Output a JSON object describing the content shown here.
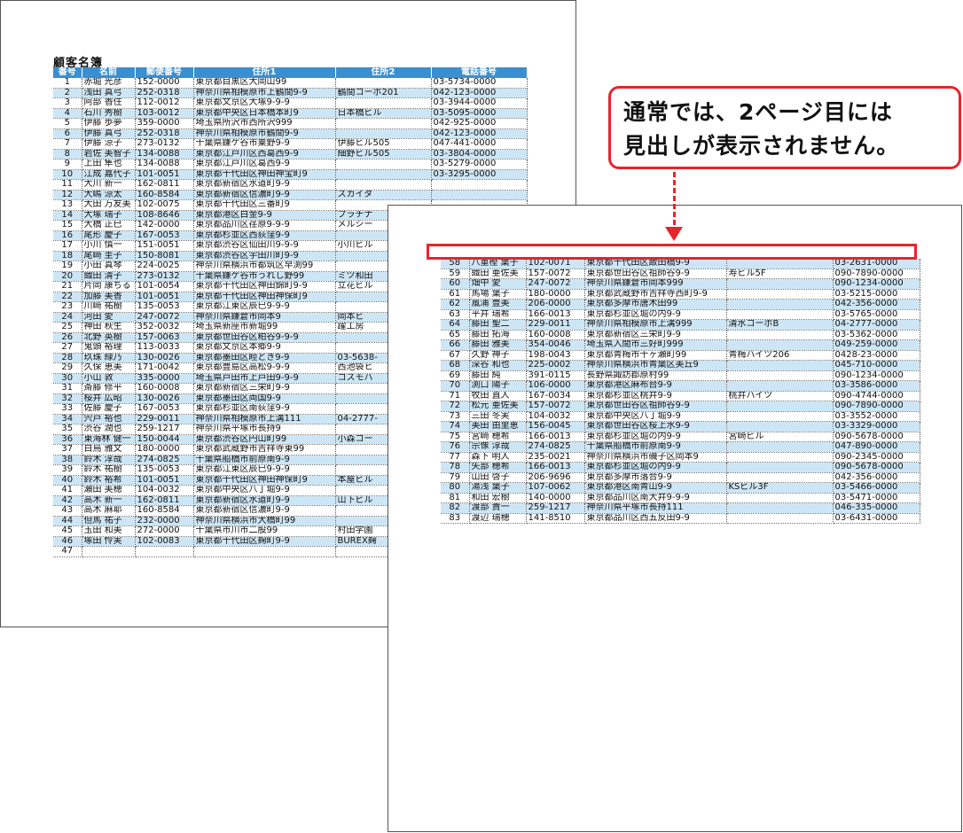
{
  "page1": {
    "title": "顧客名簿",
    "headers": [
      "番号",
      "名前",
      "郵便番号",
      "住所1",
      "住所2",
      "電話番号"
    ],
    "rows": [
      [
        "1",
        "赤堀 光彦",
        "152-0000",
        "東京都目黒区大岡山99",
        "",
        "03-5734-0000"
      ],
      [
        "2",
        "浅田 真弓",
        "252-0318",
        "神奈川県相模原市上鶴間9-9",
        "鶴間コーポ201",
        "042-123-0000"
      ],
      [
        "3",
        "阿部 香住",
        "112-0012",
        "東京都文京区大塚9-9-9",
        "",
        "03-3944-0000"
      ],
      [
        "4",
        "石川 秀樹",
        "103-0012",
        "東京都中央区日本橋本町9",
        "日本橋ビル",
        "03-5095-0000"
      ],
      [
        "5",
        "伊藤 歩夢",
        "359-0000",
        "埼玉県所沢市西所沢999",
        "",
        "042-925-0000"
      ],
      [
        "6",
        "伊藤 真弓",
        "252-0318",
        "神奈川県相模原市鶴間9-9",
        "",
        "042-123-0000"
      ],
      [
        "7",
        "伊藤 涼子",
        "273-0132",
        "千葉県鎌ケ谷市粟野9-9",
        "伊藤ビル505",
        "047-441-0000"
      ],
      [
        "8",
        "岩佐 美智子",
        "134-0088",
        "東京都江戸川区西葛西9-9",
        "細野ビル505",
        "03-3804-0000"
      ],
      [
        "9",
        "上田 隼也",
        "134-0088",
        "東京都江戸川区葛西9-9",
        "",
        "03-5279-0000"
      ],
      [
        "10",
        "江成 嘉代子",
        "101-0051",
        "東京都千代田区神田神宝町9",
        "",
        "03-3295-0000"
      ],
      [
        "11",
        "大川 新一",
        "162-0811",
        "東京都新宿区水道町9-9",
        "",
        ""
      ],
      [
        "12",
        "大嶋 涼太",
        "160-8584",
        "東京都新宿区信濃町9-9",
        "スカイタ",
        ""
      ],
      [
        "13",
        "大田 万友美",
        "102-0075",
        "東京都千代田区三番町9",
        "",
        ""
      ],
      [
        "14",
        "大塚 瑞子",
        "108-8646",
        "東京都港区白金9-9",
        "プラチナ",
        ""
      ],
      [
        "15",
        "大橋 正巳",
        "142-0000",
        "東京都品川区荏原9-9-9",
        "メルシー",
        ""
      ],
      [
        "16",
        "尾形 慶子",
        "167-0053",
        "東京都杉並区西荻窪9-9",
        "",
        ""
      ],
      [
        "17",
        "小川 慎一",
        "151-0051",
        "東京都渋谷区仙田川9-9-9",
        "小川ビル",
        ""
      ],
      [
        "18",
        "尾崎 圭子",
        "150-8081",
        "東京都渋谷区宇田川町9-9",
        "",
        ""
      ],
      [
        "19",
        "小田 真琴",
        "224-0025",
        "神奈川県横浜市都筑区早渕99",
        "",
        ""
      ],
      [
        "20",
        "織田 清子",
        "273-0132",
        "千葉県鎌ケ谷市うれし野99",
        "ミツ和田",
        ""
      ],
      [
        "21",
        "片岡 康ちる",
        "101-0054",
        "東京都千代田区神田錦町9-9",
        "立花ビル",
        ""
      ],
      [
        "22",
        "加藤 美香",
        "101-0051",
        "東京都千代田区神田神保町9",
        "",
        ""
      ],
      [
        "23",
        "川崎 祐樹",
        "135-0053",
        "東京都江東区辰巳9-9-9",
        "",
        ""
      ],
      [
        "24",
        "河田 愛",
        "247-0072",
        "神奈川県鎌倉市岡本9",
        "岡本ビ",
        ""
      ],
      [
        "25",
        "神田 秋生",
        "352-0032",
        "埼玉県新座市新堀99",
        "躍工房",
        ""
      ],
      [
        "26",
        "北野 英樹",
        "157-0063",
        "東京都世田谷区粕谷9-9-9",
        "",
        ""
      ],
      [
        "27",
        "鬼頭 裕理",
        "113-0033",
        "東京都文京区本郷9-9",
        "",
        ""
      ],
      [
        "28",
        "玖珠 緑乃",
        "130-0026",
        "東京都墨田区睦どき9-9",
        "03-5638-",
        ""
      ],
      [
        "29",
        "久保 恵美",
        "171-0042",
        "東京都豊島区高松9-9-9",
        "西池袋ヒ",
        ""
      ],
      [
        "30",
        "小山 敦",
        "335-0000",
        "埼玉県戸田市上戸田9-9-9",
        "コスモハ",
        ""
      ],
      [
        "31",
        "斎藤 修平",
        "160-0008",
        "東京都新宿区三栄町9-9",
        "",
        ""
      ],
      [
        "32",
        "桜井 広昭",
        "130-0026",
        "東京都墨田区両国9-9",
        "",
        ""
      ],
      [
        "33",
        "佐藤 慶子",
        "167-0053",
        "東京都杉並区南荻窪9-9",
        "",
        ""
      ],
      [
        "34",
        "宍戸 裕也",
        "229-0011",
        "神奈川県相模原市上溝111",
        "04-2777-",
        ""
      ],
      [
        "35",
        "渋谷 潤也",
        "259-1217",
        "神奈川県平塚市長持9",
        "",
        ""
      ],
      [
        "36",
        "東海林 健一",
        "150-0044",
        "東京都渋谷区円山町99",
        "小森コー",
        ""
      ],
      [
        "37",
        "白鳥 雅文",
        "180-0000",
        "東京都武蔵野市吉祥寺東99",
        "",
        ""
      ],
      [
        "38",
        "鈴木 淳哉",
        "274-0825",
        "千葉県船橋市前原南9-9",
        "",
        ""
      ],
      [
        "39",
        "鈴木 祐樹",
        "135-0053",
        "東京都江東区辰巳9-9-9",
        "",
        ""
      ],
      [
        "40",
        "鈴木 裕希",
        "101-0051",
        "東京都千代田区神田神保町9",
        "本屋ビル",
        ""
      ],
      [
        "41",
        "瀬田 美穂",
        "104-0032",
        "東京都中央区八丁堀9-9",
        "",
        ""
      ],
      [
        "42",
        "高木 新一",
        "162-0811",
        "東京都新宿区水道町9-9",
        "山下ビル",
        ""
      ],
      [
        "43",
        "高木 麻耶",
        "160-8584",
        "東京都新宿区信濃町9-9",
        "",
        ""
      ],
      [
        "44",
        "但馬 祐子",
        "232-0000",
        "神奈川県横浜市大橋町99",
        "",
        ""
      ],
      [
        "45",
        "玉田 和美",
        "272-0000",
        "千葉県市川市二股99",
        "村田学園",
        ""
      ],
      [
        "46",
        "塚田 怜実",
        "102-0083",
        "東京都千代田区麹町9-9",
        "BUREX麹",
        ""
      ],
      [
        "47",
        "",
        "",
        "",
        "",
        ""
      ]
    ]
  },
  "page2": {
    "rows": [
      [
        "58",
        "八重樫 葉子",
        "102-0071",
        "東京都千代田区飯田橋9-9",
        "",
        "03-2631-0000"
      ],
      [
        "59",
        "織田 亜佐美",
        "157-0072",
        "東京都世田谷区祖師谷9-9",
        "寿ビル5F",
        "090-7890-0000"
      ],
      [
        "60",
        "畑中 愛",
        "247-0072",
        "神奈川県鎌倉市岡本999",
        "",
        "090-1234-0000"
      ],
      [
        "61",
        "馬場 葉子",
        "180-0000",
        "東京都武蔵野市吉祥寺西町9-9",
        "",
        "03-5215-0000"
      ],
      [
        "62",
        "嵐浦 豊美",
        "206-0000",
        "東京都多摩市唐木田99",
        "",
        "042-356-0000"
      ],
      [
        "63",
        "平井 瑞希",
        "166-0013",
        "東京都杉並区堀の内9-9",
        "",
        "03-5765-0000"
      ],
      [
        "64",
        "藤田 聖二",
        "229-0011",
        "神奈川県相模原市上溝999",
        "清水コーポB",
        "04-2777-0000"
      ],
      [
        "65",
        "藤田 拓海",
        "160-0008",
        "東京都新宿区三栄町9-9",
        "",
        "03-5362-0000"
      ],
      [
        "66",
        "藤田 雅美",
        "354-0046",
        "埼玉県入間市三好町999",
        "",
        "049-259-0000"
      ],
      [
        "67",
        "久野 神子",
        "198-0043",
        "東京都青梅市千ヶ瀬町99",
        "青梅ハイツ206",
        "0428-23-0000"
      ],
      [
        "68",
        "深谷 和也",
        "225-0002",
        "神奈川県横浜市青葉区美丘9",
        "",
        "045-710-0000"
      ],
      [
        "69",
        "藤田 純",
        "391-0115",
        "長野県諏訪郡原村99",
        "",
        "090-1234-0000"
      ],
      [
        "70",
        "渕口 陽子",
        "106-0000",
        "東京都港区麻布台9-9",
        "",
        "03-3586-0000"
      ],
      [
        "71",
        "牧田 直人",
        "167-0034",
        "東京都杉並区桃井9-9",
        "桃井ハイツ",
        "090-4744-0000"
      ],
      [
        "72",
        "松元 亜佐美",
        "157-0072",
        "東京都世田谷区祖師谷9-9",
        "",
        "090-7890-0000"
      ],
      [
        "73",
        "三田 冬実",
        "104-0032",
        "東京都中央区八丁堀9-9",
        "",
        "03-3552-0000"
      ],
      [
        "74",
        "美田 由里恵",
        "156-0045",
        "東京都世田谷区桜上水9-9",
        "",
        "03-3329-0000"
      ],
      [
        "75",
        "宮崎 穂希",
        "166-0013",
        "東京都杉並区堀の内9-9",
        "宮崎ビル",
        "090-5678-0000"
      ],
      [
        "76",
        "宗像 淳哉",
        "274-0825",
        "千葉県船橋市前原南9-9",
        "",
        "047-890-0000"
      ],
      [
        "77",
        "森下 明人",
        "235-0021",
        "神奈川県横浜市磯子区岡本9",
        "",
        "090-2345-0000"
      ],
      [
        "78",
        "矢部 穂希",
        "166-0013",
        "東京都杉並区堀の内9-9",
        "",
        "090-5678-0000"
      ],
      [
        "79",
        "山田 啓子",
        "206-9696",
        "東京都多摩市落合9-9",
        "",
        "042-356-0000"
      ],
      [
        "80",
        "湯浅 葉子",
        "107-0062",
        "東京都港区南青山9-9",
        "KSビル3F",
        "03-5466-0000"
      ],
      [
        "81",
        "和田 宏樹",
        "140-0000",
        "東京都品川区南大井9-9-9",
        "",
        "03-5471-0000"
      ],
      [
        "82",
        "渡部 貴一",
        "259-1217",
        "神奈川県平塚市長持111",
        "",
        "046-335-0000"
      ],
      [
        "83",
        "渡辺 瑞穂",
        "141-8510",
        "東京都品川区西五反田9-9",
        "",
        "03-6431-0000"
      ]
    ]
  },
  "callout": {
    "line1": "通常では、2ページ目には",
    "line2": "見出しが表示されません。"
  },
  "colors": {
    "header_bg": "#3a8fd0",
    "band_bg": "#cde6f6",
    "accent": "#e5252c"
  }
}
